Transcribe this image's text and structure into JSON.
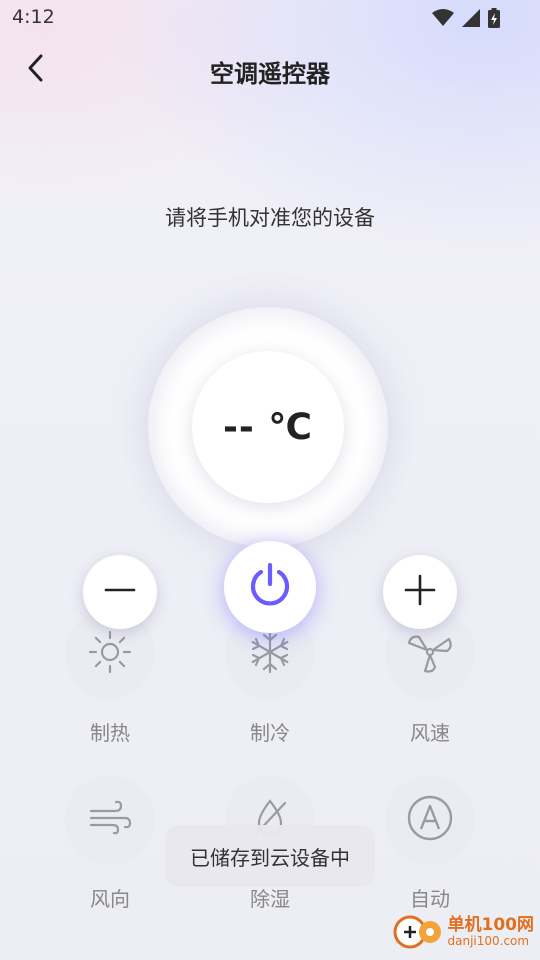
{
  "status_bar": {
    "time": "4:12"
  },
  "header": {
    "title": "空调遥控器"
  },
  "hint": "请将手机对准您的设备",
  "dial": {
    "temperature": "-- ℃"
  },
  "modes": [
    {
      "label": "制热",
      "icon": "sun-icon"
    },
    {
      "label": "制冷",
      "icon": "snowflake-icon"
    },
    {
      "label": "风速",
      "icon": "fan-icon"
    },
    {
      "label": "风向",
      "icon": "wind-icon"
    },
    {
      "label": "除湿",
      "icon": "dehumidify-icon"
    },
    {
      "label": "自动",
      "icon": "auto-icon"
    }
  ],
  "toast": "已储存到云设备中",
  "watermark": {
    "main": "单机100网",
    "sub": "danji100.com"
  },
  "colors": {
    "accent": "#6a5cff",
    "icon_gray": "#9a9aa3"
  }
}
